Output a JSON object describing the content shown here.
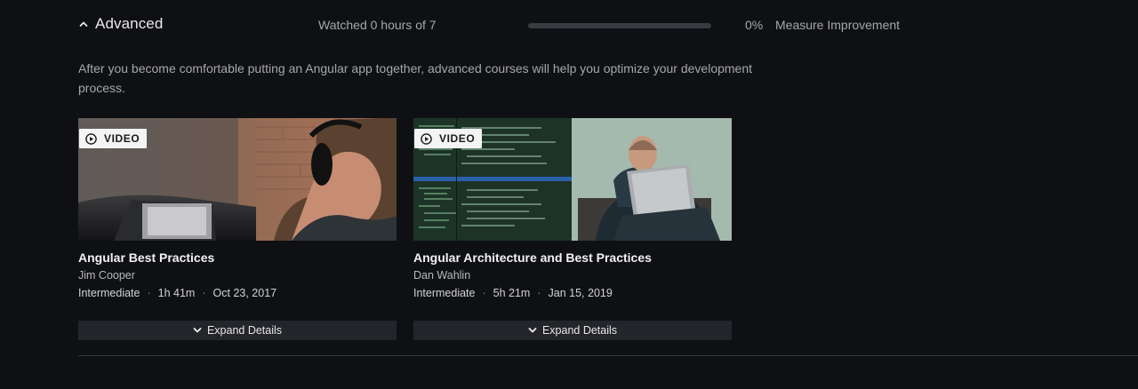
{
  "section": {
    "title": "Advanced",
    "watched_text": "Watched 0 hours of 7",
    "progress_percent": 0,
    "progress_label": "0%",
    "measure_label": "Measure Improvement",
    "description": "After you become comfortable putting an Angular app together, advanced courses will help you optimize your development process."
  },
  "colors": {
    "background": "#0f1014",
    "progress_track": "#3a3b40",
    "progress_fill": "#ec7a3a",
    "expand_button_bg": "#24252a"
  },
  "courses": [
    {
      "badge": "VIDEO",
      "title": "Angular Best Practices",
      "author": "Jim Cooper",
      "level": "Intermediate",
      "duration": "1h 41m",
      "date": "Oct 23, 2017",
      "expand_label": "Expand Details"
    },
    {
      "badge": "VIDEO",
      "title": "Angular Architecture and Best Practices",
      "author": "Dan Wahlin",
      "level": "Intermediate",
      "duration": "5h 21m",
      "date": "Jan 15, 2019",
      "expand_label": "Expand Details"
    }
  ],
  "icons": {
    "section_toggle": "chevron-up-icon",
    "badge": "play-circle-icon",
    "expand": "chevron-down-icon"
  }
}
